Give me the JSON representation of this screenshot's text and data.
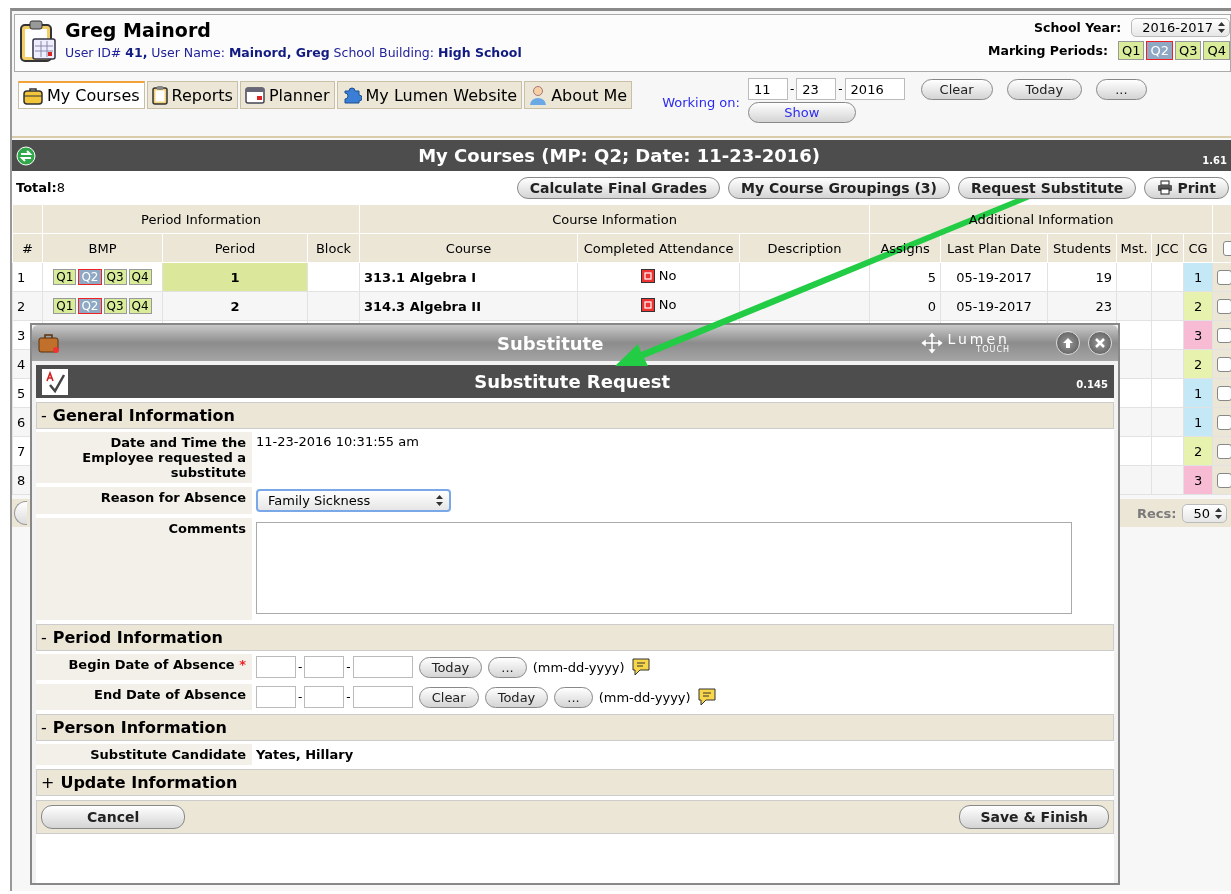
{
  "header": {
    "name": "Greg Mainord",
    "info": "User ID# **41,** User Name: **Mainord, Greg**  School Building: **High School**",
    "school_year_label": "School Year:",
    "school_year": "2016-2017",
    "marking_periods_label": "Marking Periods:",
    "marking_periods": [
      {
        "label": "Q1",
        "selected": false
      },
      {
        "label": "Q2",
        "selected": true
      },
      {
        "label": "Q3",
        "selected": false
      },
      {
        "label": "Q4",
        "selected": false
      }
    ]
  },
  "tabs": [
    {
      "label": "My Courses",
      "selected": true
    },
    {
      "label": "Reports",
      "selected": false
    },
    {
      "label": "Planner",
      "selected": false
    },
    {
      "label": "My Lumen Website",
      "selected": false
    },
    {
      "label": "About Me",
      "selected": false
    }
  ],
  "working_on": {
    "label": "Working on:",
    "month": "11",
    "day": "23",
    "year": "2016",
    "separator": "-",
    "buttons": [
      "Clear",
      "Today",
      "..."
    ],
    "show": "Show"
  },
  "courses_bar": {
    "title": "My Courses (MP: Q2; Date: 11-23-2016)",
    "version": "1.61"
  },
  "toolbar": {
    "total_label": "Total:",
    "total": "8",
    "buttons": [
      {
        "label": "Calculate Final Grades"
      },
      {
        "label": "My Course Groupings (3)"
      },
      {
        "label": "Request Substitute"
      },
      {
        "label": "Print"
      }
    ]
  },
  "table": {
    "column_groups": [
      {
        "columns": [
          "#"
        ]
      },
      {
        "label": "Period Information",
        "columns": [
          "BMP",
          "Period",
          "Block"
        ]
      },
      {
        "label": "Course Information",
        "columns": [
          "Course",
          "Completed Attendance",
          "Description"
        ]
      },
      {
        "label": "Additional Information",
        "columns": [
          "Assigns",
          "Last Plan Date",
          "Students",
          "Mst.",
          "JCC",
          "CG"
        ]
      }
    ],
    "header_checkbox": {
      "checked": false
    },
    "rows": [
      {
        "num": "1",
        "bmp": [
          {
            "label": "Q1",
            "selected": false
          },
          {
            "label": "Q2",
            "selected": true
          },
          {
            "label": "Q3",
            "selected": false
          },
          {
            "label": "Q4",
            "selected": false
          }
        ],
        "period": "1",
        "period_current": true,
        "course": "313.1 Algebra I",
        "attendance": "No",
        "attendance_done": false,
        "assigns": "5",
        "last_plan_date": "05-19-2017",
        "students": "19",
        "cg": "1",
        "color": "#c4e8f6",
        "checked": false
      },
      {
        "num": "2",
        "bmp": [
          {
            "label": "Q1",
            "selected": false
          },
          {
            "label": "Q2",
            "selected": true
          },
          {
            "label": "Q3",
            "selected": false
          },
          {
            "label": "Q4",
            "selected": false
          }
        ],
        "period": "2",
        "period_current": false,
        "course": "314.3 Algebra II",
        "attendance": "No",
        "attendance_done": false,
        "assigns": "0",
        "last_plan_date": "05-19-2017",
        "students": "23",
        "cg": "2",
        "color": "#e6f2ae",
        "checked": false
      },
      {
        "num": "3",
        "cg": "3",
        "color": "#f7bcd3",
        "checked": false
      },
      {
        "num": "4",
        "cg": "2",
        "color": "#e6f2ae",
        "checked": false
      },
      {
        "num": "5",
        "cg": "1",
        "color": "#c4e8f6",
        "checked": false
      },
      {
        "num": "6",
        "cg": "1",
        "color": "#c4e8f6",
        "checked": false
      },
      {
        "num": "7",
        "cg": "2",
        "color": "#e6f2ae",
        "checked": false
      },
      {
        "num": "8",
        "cg": "3",
        "color": "#f7bcd3",
        "checked": false
      }
    ]
  },
  "footer": {
    "recs_label": "Recs:",
    "recs": "50"
  },
  "modal": {
    "title": "Substitute",
    "logo": {
      "name": "Lumen",
      "sub": "TOUCH"
    },
    "form_title": "Substitute Request",
    "version": "0.145",
    "sections": [
      {
        "toggle": "-",
        "title": "General Information",
        "fields": [
          {
            "kind": "text",
            "label": "Date and Time the Employee requested a substitute",
            "value": "11-23-2016 10:31:55 am"
          },
          {
            "kind": "select",
            "label": "Reason for Absence",
            "value": "Family Sickness"
          },
          {
            "kind": "textarea",
            "label": "Comments"
          }
        ]
      },
      {
        "toggle": "-",
        "title": "Period Information",
        "fields": [
          {
            "kind": "date",
            "label": "Begin Date of Absence",
            "required": true,
            "separator": "-",
            "buttons": [
              "Today",
              "..."
            ],
            "format": "(mm-dd-yyyy)"
          },
          {
            "kind": "date",
            "label": "End Date of Absence",
            "required": false,
            "separator": "-",
            "buttons": [
              "Clear",
              "Today",
              "..."
            ],
            "format": "(mm-dd-yyyy)"
          }
        ]
      },
      {
        "toggle": "-",
        "title": "Person Information",
        "fields": [
          {
            "kind": "strong",
            "label": "Substitute Candidate",
            "value": "Yates, Hillary"
          }
        ]
      },
      {
        "toggle": "+",
        "title": "Update Information"
      }
    ],
    "required_mark": "*",
    "cancel": "Cancel",
    "save": "Save & Finish"
  }
}
